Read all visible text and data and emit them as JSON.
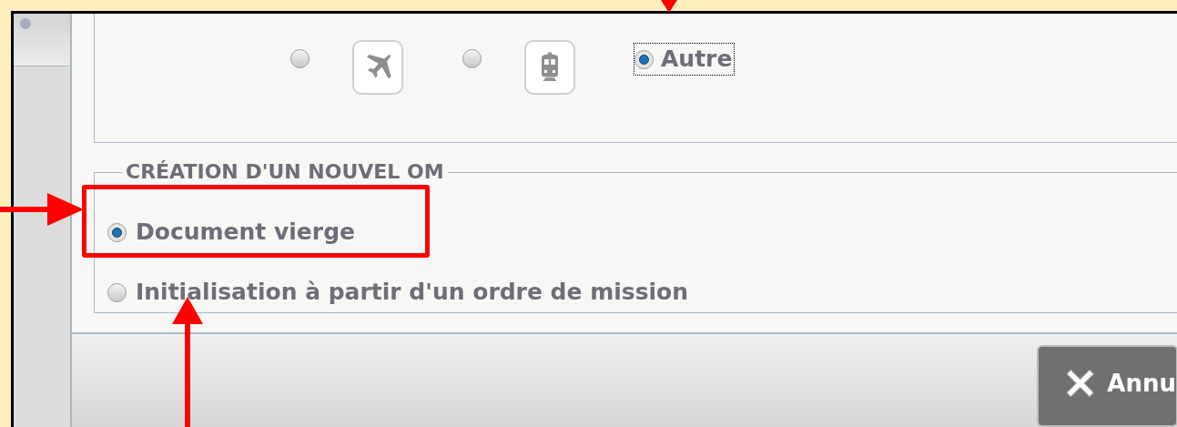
{
  "transport": {
    "options": [
      {
        "kind": "plane",
        "selected": false,
        "focused": false
      },
      {
        "kind": "train",
        "selected": false,
        "focused": false
      },
      {
        "kind": "text",
        "label": "Autre",
        "selected": true,
        "focused": true
      }
    ]
  },
  "creation": {
    "legend": "CRÉATION D'UN NOUVEL OM",
    "options": [
      {
        "label": "Document vierge",
        "selected": true
      },
      {
        "label": "Initialisation à partir d'un ordre de mission",
        "selected": false
      }
    ]
  },
  "footer": {
    "cancel_button": "Annu"
  }
}
